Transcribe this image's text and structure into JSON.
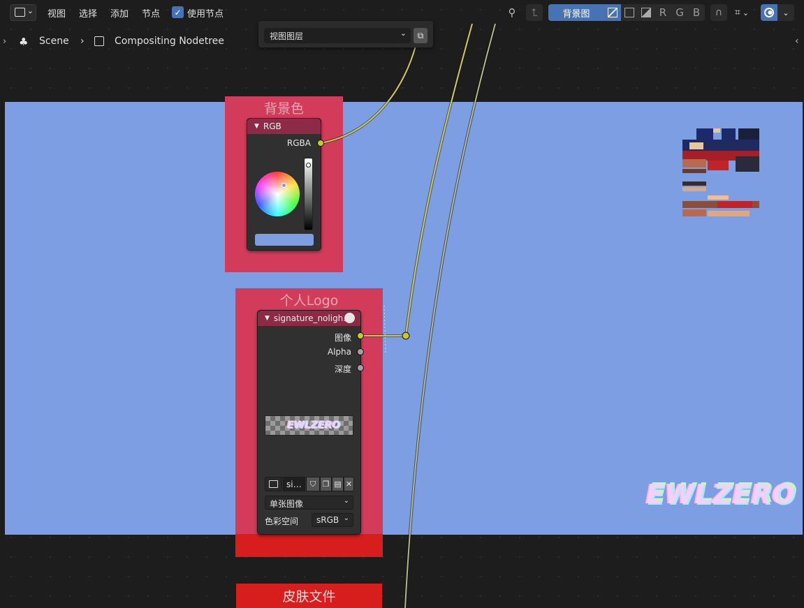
{
  "header": {
    "menus": [
      "视图",
      "选择",
      "添加",
      "节点"
    ],
    "use_nodes_label": "使用节点",
    "use_nodes_checked": true,
    "backdrop_label": "背景图",
    "channel_letters": [
      "R",
      "G",
      "B"
    ]
  },
  "breadcrumb": {
    "scene": "Scene",
    "tree": "Compositing Nodetree"
  },
  "popup": {
    "view_layer_label": "视图图层"
  },
  "frames": {
    "bg_color": "背景色",
    "logo": "个人Logo",
    "skin_file": "皮肤文件"
  },
  "rgb_node": {
    "title": "RGB",
    "output": "RGBA",
    "swatch_color": "#7d9ee2"
  },
  "image_node": {
    "title": "signature_noligh…",
    "outputs": [
      "图像",
      "Alpha",
      "深度"
    ],
    "file_short": "si…",
    "source": "单张图像",
    "colorspace_label": "色彩空间",
    "colorspace": "sRGB"
  },
  "logo_text": "EWLZERO",
  "colors": {
    "accent": "#4772b3",
    "frame": "#d23c5a",
    "frame_skin": "#d81d1d",
    "backdrop": "#7d9ee2",
    "link": "#c8c45a"
  }
}
